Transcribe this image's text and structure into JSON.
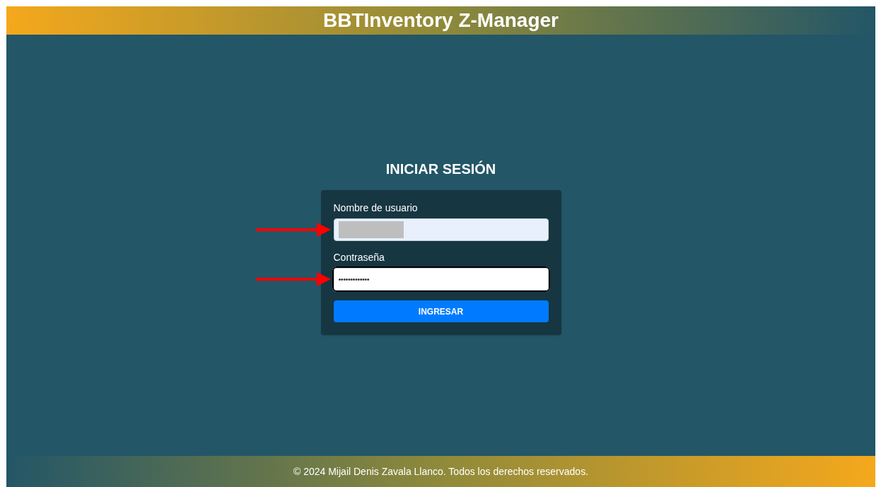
{
  "header": {
    "title": "BBTInventory Z-Manager"
  },
  "login": {
    "title": "INICIAR SESIÓN",
    "fields": [
      {
        "label": "Nombre de usuario",
        "kind": "text",
        "redacted": true,
        "focused": false,
        "pointed": true
      },
      {
        "label": "Contraseña",
        "kind": "password",
        "value": "•••••••••••••",
        "redacted": false,
        "focused": true,
        "pointed": true
      }
    ],
    "button": "INGRESAR"
  },
  "footer": {
    "text": "© 2024 Mijail Denis Zavala Llanco. Todos los derechos reservados."
  }
}
